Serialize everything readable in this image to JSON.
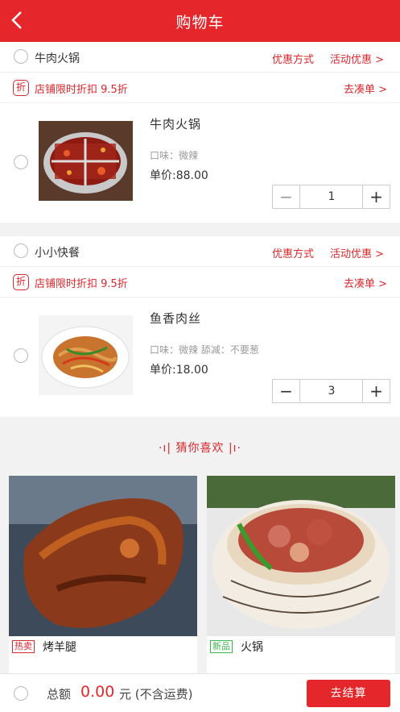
{
  "header": {
    "title": "购物车"
  },
  "shops": [
    {
      "name": "牛肉火锅",
      "coupon_link": "优惠方式",
      "activity_link": "活动优惠 >",
      "discount_icon": "折",
      "discount_text": "店铺限时折扣 9.5折",
      "go_link": "去凑单 >",
      "item": {
        "name": "牛肉火锅",
        "flavor": "口味：微辣",
        "price": "单价:88.00",
        "qty": "1",
        "minus": "−",
        "plus": "+"
      }
    },
    {
      "name": "小小快餐",
      "coupon_link": "优惠方式",
      "activity_link": "活动优惠 >",
      "discount_icon": "折",
      "discount_text": "店铺限时折扣 9.5折",
      "go_link": "去凑单 >",
      "item": {
        "name": "鱼香肉丝",
        "flavor": "口味：微辣 舔减：不要葱",
        "price": "单价:18.00",
        "qty": "3",
        "minus": "−",
        "plus": "+"
      }
    }
  ],
  "guess": {
    "title": "猜你喜欢",
    "cards": [
      {
        "tag": "热卖",
        "name": "烤羊腿",
        "tag_color": "#d9272d"
      },
      {
        "tag": "新品",
        "name": "火锅",
        "tag_color": "#3ab54a"
      }
    ]
  },
  "footer": {
    "total_label": "总额",
    "total_amount": "0.00",
    "total_unit": "元 (不含运费)",
    "checkout": "去结算"
  },
  "colors": {
    "brand": "#e5262b",
    "accent_text": "#d9272d"
  }
}
